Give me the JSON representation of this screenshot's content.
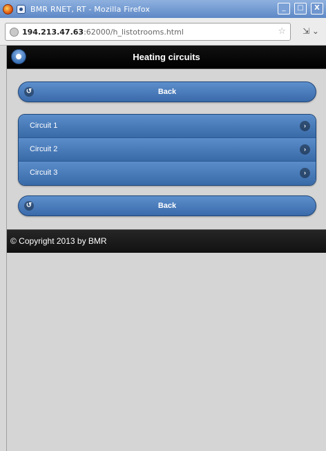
{
  "window": {
    "title": "BMR RNET, RT - Mozilla Firefox",
    "buttons": {
      "minimize": "_",
      "maximize": "□",
      "close": "X"
    }
  },
  "browser": {
    "url_host": "194.213.47.63",
    "url_path": ":62000/h_listotrooms.html",
    "nav_extra": "⇲ ⌄"
  },
  "page": {
    "title": "Heating circuits",
    "back_label": "Back",
    "circuits": [
      {
        "label": "Circuit 1"
      },
      {
        "label": "Circuit 2"
      },
      {
        "label": "Circuit 3"
      }
    ],
    "footer": "© Copyright 2013 by BMR"
  },
  "icons": {
    "home": "home-icon",
    "back": "back-arrow-icon",
    "item": "chevron-right-icon"
  },
  "colors": {
    "accent": "#3f72b2",
    "header_bg": "#000000",
    "footer_bg": "#1a1a1a",
    "page_bg": "#d5d5d5"
  }
}
